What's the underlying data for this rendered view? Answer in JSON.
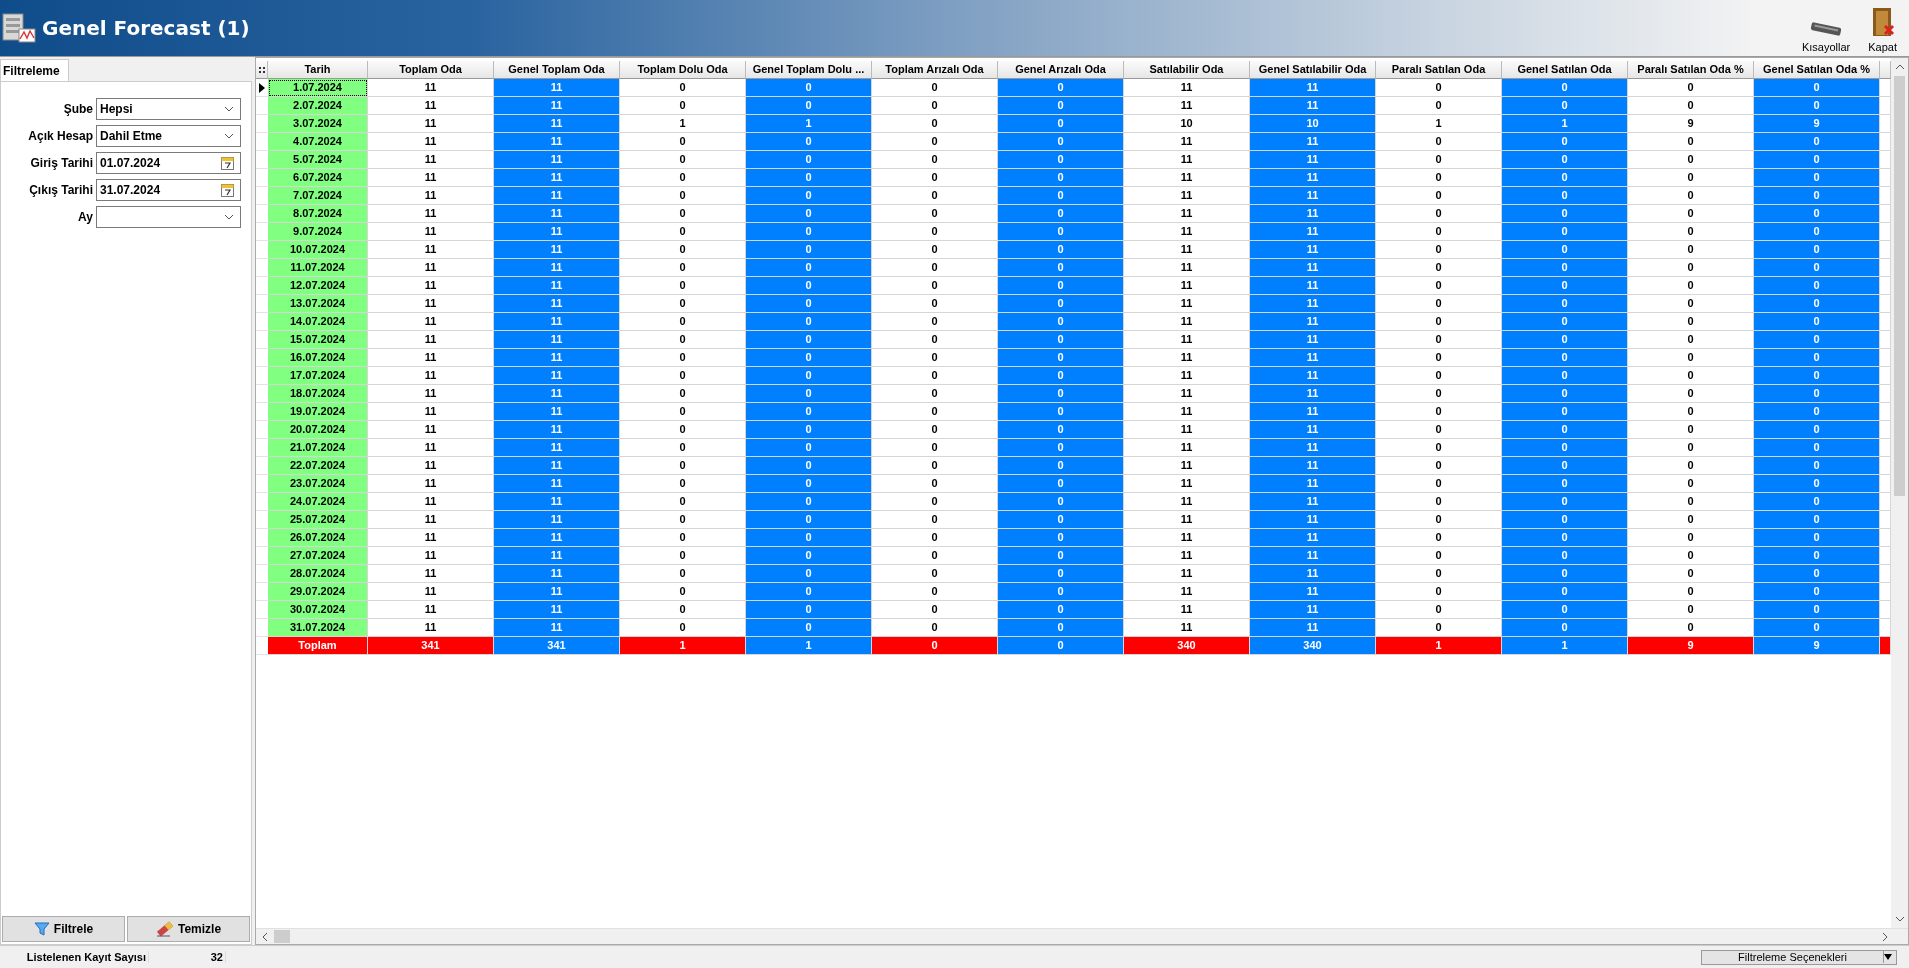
{
  "window": {
    "title": "Genel Forecast (1)"
  },
  "toolbar": [
    {
      "label": "Kısayollar",
      "kind": "keyboard"
    },
    {
      "label": "Kapat",
      "kind": "close"
    }
  ],
  "filter_panel": {
    "tab": {
      "label": "Filtreleme",
      "selected": true
    },
    "fields": [
      {
        "label": "Şube",
        "kind": "dropdown",
        "value": "Hepsi"
      },
      {
        "label": "Açık Hesap",
        "kind": "dropdown",
        "value": "Dahil Etme"
      },
      {
        "label": "Giriş Tarihi",
        "kind": "date",
        "value": "01.07.2024"
      },
      {
        "label": "Çıkış Tarihi",
        "kind": "date",
        "value": "31.07.2024"
      },
      {
        "label": "Ay",
        "kind": "dropdown"
      }
    ],
    "buttons": [
      {
        "label": "Filtrele",
        "kind": "filter"
      },
      {
        "label": "Temizle",
        "kind": "clear"
      }
    ]
  },
  "table": {
    "columns": [
      {
        "label": "Tarih",
        "kind": "date"
      },
      {
        "label": "Toplam Oda",
        "kind": "count"
      },
      {
        "label": "Genel Toplam Oda",
        "kind": "general"
      },
      {
        "label": "Toplam Dolu Oda",
        "kind": "count"
      },
      {
        "label": "Genel Toplam Dolu ...",
        "kind": "general"
      },
      {
        "label": "Toplam Arızalı Oda",
        "kind": "count"
      },
      {
        "label": "Genel Arızalı Oda",
        "kind": "general"
      },
      {
        "label": "Satılabilir Oda",
        "kind": "count"
      },
      {
        "label": "Genel Satılabilir Oda",
        "kind": "general"
      },
      {
        "label": "Paralı Satılan Oda",
        "kind": "count"
      },
      {
        "label": "Genel Satılan Oda",
        "kind": "general"
      },
      {
        "label": "Paralı Satılan Oda %",
        "kind": "count"
      },
      {
        "label": "Genel Satılan Oda %",
        "kind": "general"
      }
    ],
    "rows": [
      {
        "selected": true,
        "cells": [
          "1.07.2024",
          "11",
          "11",
          "0",
          "0",
          "0",
          "0",
          "11",
          "11",
          "0",
          "0",
          "0",
          "0"
        ]
      },
      {
        "selected": false,
        "cells": [
          "2.07.2024",
          "11",
          "11",
          "0",
          "0",
          "0",
          "0",
          "11",
          "11",
          "0",
          "0",
          "0",
          "0"
        ]
      },
      {
        "selected": false,
        "cells": [
          "3.07.2024",
          "11",
          "11",
          "1",
          "1",
          "0",
          "0",
          "10",
          "10",
          "1",
          "1",
          "9",
          "9"
        ]
      },
      {
        "selected": false,
        "cells": [
          "4.07.2024",
          "11",
          "11",
          "0",
          "0",
          "0",
          "0",
          "11",
          "11",
          "0",
          "0",
          "0",
          "0"
        ]
      },
      {
        "selected": false,
        "cells": [
          "5.07.2024",
          "11",
          "11",
          "0",
          "0",
          "0",
          "0",
          "11",
          "11",
          "0",
          "0",
          "0",
          "0"
        ]
      },
      {
        "selected": false,
        "cells": [
          "6.07.2024",
          "11",
          "11",
          "0",
          "0",
          "0",
          "0",
          "11",
          "11",
          "0",
          "0",
          "0",
          "0"
        ]
      },
      {
        "selected": false,
        "cells": [
          "7.07.2024",
          "11",
          "11",
          "0",
          "0",
          "0",
          "0",
          "11",
          "11",
          "0",
          "0",
          "0",
          "0"
        ]
      },
      {
        "selected": false,
        "cells": [
          "8.07.2024",
          "11",
          "11",
          "0",
          "0",
          "0",
          "0",
          "11",
          "11",
          "0",
          "0",
          "0",
          "0"
        ]
      },
      {
        "selected": false,
        "cells": [
          "9.07.2024",
          "11",
          "11",
          "0",
          "0",
          "0",
          "0",
          "11",
          "11",
          "0",
          "0",
          "0",
          "0"
        ]
      },
      {
        "selected": false,
        "cells": [
          "10.07.2024",
          "11",
          "11",
          "0",
          "0",
          "0",
          "0",
          "11",
          "11",
          "0",
          "0",
          "0",
          "0"
        ]
      },
      {
        "selected": false,
        "cells": [
          "11.07.2024",
          "11",
          "11",
          "0",
          "0",
          "0",
          "0",
          "11",
          "11",
          "0",
          "0",
          "0",
          "0"
        ]
      },
      {
        "selected": false,
        "cells": [
          "12.07.2024",
          "11",
          "11",
          "0",
          "0",
          "0",
          "0",
          "11",
          "11",
          "0",
          "0",
          "0",
          "0"
        ]
      },
      {
        "selected": false,
        "cells": [
          "13.07.2024",
          "11",
          "11",
          "0",
          "0",
          "0",
          "0",
          "11",
          "11",
          "0",
          "0",
          "0",
          "0"
        ]
      },
      {
        "selected": false,
        "cells": [
          "14.07.2024",
          "11",
          "11",
          "0",
          "0",
          "0",
          "0",
          "11",
          "11",
          "0",
          "0",
          "0",
          "0"
        ]
      },
      {
        "selected": false,
        "cells": [
          "15.07.2024",
          "11",
          "11",
          "0",
          "0",
          "0",
          "0",
          "11",
          "11",
          "0",
          "0",
          "0",
          "0"
        ]
      },
      {
        "selected": false,
        "cells": [
          "16.07.2024",
          "11",
          "11",
          "0",
          "0",
          "0",
          "0",
          "11",
          "11",
          "0",
          "0",
          "0",
          "0"
        ]
      },
      {
        "selected": false,
        "cells": [
          "17.07.2024",
          "11",
          "11",
          "0",
          "0",
          "0",
          "0",
          "11",
          "11",
          "0",
          "0",
          "0",
          "0"
        ]
      },
      {
        "selected": false,
        "cells": [
          "18.07.2024",
          "11",
          "11",
          "0",
          "0",
          "0",
          "0",
          "11",
          "11",
          "0",
          "0",
          "0",
          "0"
        ]
      },
      {
        "selected": false,
        "cells": [
          "19.07.2024",
          "11",
          "11",
          "0",
          "0",
          "0",
          "0",
          "11",
          "11",
          "0",
          "0",
          "0",
          "0"
        ]
      },
      {
        "selected": false,
        "cells": [
          "20.07.2024",
          "11",
          "11",
          "0",
          "0",
          "0",
          "0",
          "11",
          "11",
          "0",
          "0",
          "0",
          "0"
        ]
      },
      {
        "selected": false,
        "cells": [
          "21.07.2024",
          "11",
          "11",
          "0",
          "0",
          "0",
          "0",
          "11",
          "11",
          "0",
          "0",
          "0",
          "0"
        ]
      },
      {
        "selected": false,
        "cells": [
          "22.07.2024",
          "11",
          "11",
          "0",
          "0",
          "0",
          "0",
          "11",
          "11",
          "0",
          "0",
          "0",
          "0"
        ]
      },
      {
        "selected": false,
        "cells": [
          "23.07.2024",
          "11",
          "11",
          "0",
          "0",
          "0",
          "0",
          "11",
          "11",
          "0",
          "0",
          "0",
          "0"
        ]
      },
      {
        "selected": false,
        "cells": [
          "24.07.2024",
          "11",
          "11",
          "0",
          "0",
          "0",
          "0",
          "11",
          "11",
          "0",
          "0",
          "0",
          "0"
        ]
      },
      {
        "selected": false,
        "cells": [
          "25.07.2024",
          "11",
          "11",
          "0",
          "0",
          "0",
          "0",
          "11",
          "11",
          "0",
          "0",
          "0",
          "0"
        ]
      },
      {
        "selected": false,
        "cells": [
          "26.07.2024",
          "11",
          "11",
          "0",
          "0",
          "0",
          "0",
          "11",
          "11",
          "0",
          "0",
          "0",
          "0"
        ]
      },
      {
        "selected": false,
        "cells": [
          "27.07.2024",
          "11",
          "11",
          "0",
          "0",
          "0",
          "0",
          "11",
          "11",
          "0",
          "0",
          "0",
          "0"
        ]
      },
      {
        "selected": false,
        "cells": [
          "28.07.2024",
          "11",
          "11",
          "0",
          "0",
          "0",
          "0",
          "11",
          "11",
          "0",
          "0",
          "0",
          "0"
        ]
      },
      {
        "selected": false,
        "cells": [
          "29.07.2024",
          "11",
          "11",
          "0",
          "0",
          "0",
          "0",
          "11",
          "11",
          "0",
          "0",
          "0",
          "0"
        ]
      },
      {
        "selected": false,
        "cells": [
          "30.07.2024",
          "11",
          "11",
          "0",
          "0",
          "0",
          "0",
          "11",
          "11",
          "0",
          "0",
          "0",
          "0"
        ]
      },
      {
        "selected": false,
        "cells": [
          "31.07.2024",
          "11",
          "11",
          "0",
          "0",
          "0",
          "0",
          "11",
          "11",
          "0",
          "0",
          "0",
          "0"
        ]
      }
    ],
    "total": {
      "cells": [
        "Toplam",
        "341",
        "341",
        "1",
        "1",
        "0",
        "0",
        "340",
        "340",
        "1",
        "1",
        "9",
        "9"
      ]
    }
  },
  "status_bar": {
    "label": "Listelenen Kayıt Sayısı",
    "value": "32",
    "options_button": "Filtreleme Seçenekleri"
  }
}
